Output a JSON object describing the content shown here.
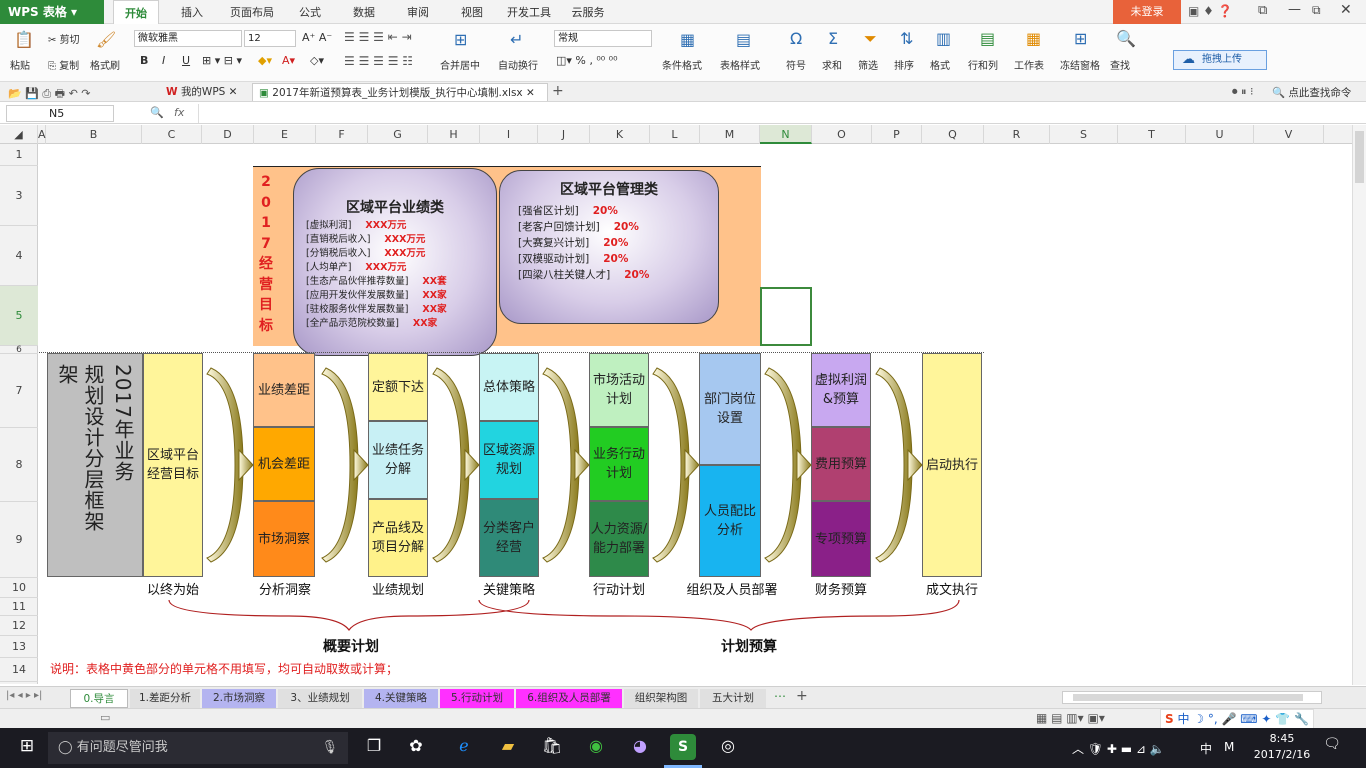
{
  "app": {
    "name": "WPS 表格",
    "login": "未登录",
    "upload": "拖拽上传"
  },
  "menu": [
    {
      "label": "开始",
      "active": true
    },
    {
      "label": "插入"
    },
    {
      "label": "页面布局"
    },
    {
      "label": "公式"
    },
    {
      "label": "数据"
    },
    {
      "label": "审阅"
    },
    {
      "label": "视图"
    },
    {
      "label": "开发工具"
    },
    {
      "label": "云服务"
    }
  ],
  "ribbon": {
    "paste": "粘贴",
    "cut": "剪切",
    "copy": "复制",
    "format_painter": "格式刷",
    "font": "微软雅黑",
    "size": "12",
    "number_format": "常规",
    "merge": "合并居中",
    "wrap": "自动换行",
    "cond_format": "条件格式",
    "table_style": "表格样式",
    "symbol": "符号",
    "sum": "求和",
    "filter": "筛选",
    "sort": "排序",
    "format": "格式",
    "rowcol": "行和列",
    "sheet": "工作表",
    "freeze": "冻结窗格",
    "find": "查找"
  },
  "doctabs": {
    "mywps": "我的WPS",
    "file": "2017年新道预算表_业务计划模版_执行中心填制.xlsx",
    "search": "点此查找命令"
  },
  "formula": {
    "cell": "N5",
    "fx": "fx"
  },
  "columns": [
    "A",
    "B",
    "C",
    "D",
    "E",
    "F",
    "G",
    "H",
    "I",
    "J",
    "K",
    "L",
    "M",
    "N",
    "O",
    "P",
    "Q",
    "R",
    "S",
    "T",
    "U",
    "V"
  ],
  "rows": [
    "1",
    "3",
    "4",
    "5",
    "6",
    "7",
    "8",
    "9",
    "10",
    "11",
    "12",
    "13",
    "14"
  ],
  "goal": {
    "vertical": [
      "2",
      "0",
      "1",
      "7",
      "经",
      "营",
      "目",
      "标"
    ],
    "perf_title": "区域平台业绩类",
    "perf_items": [
      {
        "k": "[虚拟利润]",
        "v": "XXX万元"
      },
      {
        "k": "[直销税后收入]",
        "v": "XXX万元"
      },
      {
        "k": "[分销税后收入]",
        "v": "XXX万元"
      },
      {
        "k": "[人均单产]",
        "v": "XXX万元"
      },
      {
        "k": "[生态产品伙伴推荐数量]",
        "v": "XX套"
      },
      {
        "k": "[应用开发伙伴发展数量]",
        "v": "XX家"
      },
      {
        "k": "[驻校服务伙伴发展数量]",
        "v": "XX家"
      },
      {
        "k": "[全产品示范院校数量]",
        "v": "XX家"
      }
    ],
    "mgmt_title": "区域平台管理类",
    "mgmt_items": [
      {
        "k": "[强省区计划]",
        "v": "20%"
      },
      {
        "k": "[老客户回馈计划]",
        "v": "20%"
      },
      {
        "k": "[大赛复兴计划]",
        "v": "20%"
      },
      {
        "k": "[双模驱动计划]",
        "v": "20%"
      },
      {
        "k": "[四梁八柱关键人才]",
        "v": "20%"
      }
    ]
  },
  "framework": {
    "title_left": "规划设计分层框架",
    "title_right": "2017年业务",
    "c1": "区域平台经营目标",
    "c2": [
      "业绩差距",
      "机会差距",
      "市场洞察"
    ],
    "c3": [
      "定额下达",
      "业绩任务分解",
      "产品线及项目分解"
    ],
    "c4": [
      "总体策略",
      "区域资源规划",
      "分类客户经营"
    ],
    "c5": [
      "市场活动计划",
      "业务行动计划",
      "人力资源/能力部署"
    ],
    "c6": [
      "部门岗位设置",
      "人员配比分析"
    ],
    "c7": [
      "虚拟利润&预算",
      "费用预算",
      "专项预算"
    ],
    "c8": "启动执行",
    "labels": [
      "以终为始",
      "分析洞察",
      "业绩规划",
      "关键策略",
      "行动计划",
      "组织及人员部署",
      "财务预算",
      "成文执行"
    ],
    "brace_left": "概要计划",
    "brace_right": "计划预算",
    "note": "说明：表格中黄色部分的单元格不用填写，均可自动取数或计算；"
  },
  "sheettabs": [
    "0.导言",
    "1.差距分析",
    "2.市场洞察",
    "3、业绩规划",
    "4.关键策略",
    "5.行动计划",
    "6.组织及人员部署",
    "组织架构图",
    "五大计划"
  ],
  "taskbar": {
    "search": "有问题尽管问我",
    "time": "8:45",
    "date": "2017/2/16",
    "ime": "中",
    "ime2": "M"
  },
  "colors": {
    "green": "#2e8b3a",
    "orange": "#ffc28a",
    "purple": "#b8a8d8",
    "red": "#e02020"
  }
}
